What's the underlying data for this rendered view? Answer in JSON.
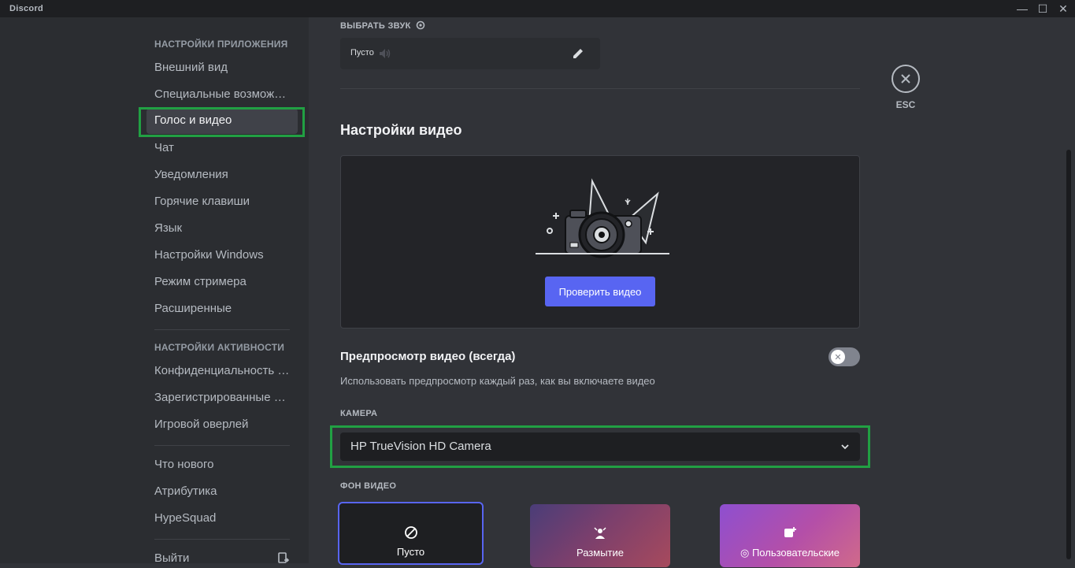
{
  "window": {
    "title": "Discord",
    "minimize_glyph": "—",
    "maximize_glyph": "☐",
    "close_glyph": "✕"
  },
  "sidebar": {
    "app_settings_header": "НАСТРОЙКИ ПРИЛОЖЕНИЯ",
    "app_items": [
      {
        "label": "Внешний вид",
        "active": false
      },
      {
        "label": "Специальные возмож…",
        "active": false
      },
      {
        "label": "Голос и видео",
        "active": true
      },
      {
        "label": "Чат",
        "active": false
      },
      {
        "label": "Уведомления",
        "active": false
      },
      {
        "label": "Горячие клавиши",
        "active": false
      },
      {
        "label": "Язык",
        "active": false
      },
      {
        "label": "Настройки Windows",
        "active": false
      },
      {
        "label": "Режим стримера",
        "active": false
      },
      {
        "label": "Расширенные",
        "active": false
      }
    ],
    "activity_settings_header": "НАСТРОЙКИ АКТИВНОСТИ",
    "activity_items": [
      {
        "label": "Конфиденциальность …"
      },
      {
        "label": "Зарегистрированные …"
      },
      {
        "label": "Игровой оверлей"
      }
    ],
    "misc_items": [
      {
        "label": "Что нового"
      },
      {
        "label": "Атрибутика"
      },
      {
        "label": "HypeSquad"
      }
    ],
    "logout_label": "Выйти"
  },
  "sound": {
    "label": "ВЫБРАТЬ ЗВУК",
    "value": "Пусто"
  },
  "video": {
    "title": "Настройки видео",
    "test_button": "Проверить видео",
    "preview_title": "Предпросмотр видео (всегда)",
    "preview_desc": "Использовать предпросмотр каждый раз, как вы включаете видео",
    "preview_enabled": false,
    "camera_label": "КАМЕРА",
    "camera_value": "HP TrueVision HD Camera",
    "background_label": "ФОН ВИДЕО",
    "backgrounds": [
      {
        "label": "Пусто",
        "selected": true
      },
      {
        "label": "Размытие",
        "selected": false
      },
      {
        "label": "Пользовательские",
        "selected": false
      }
    ]
  },
  "close": {
    "label": "ESC"
  },
  "colors": {
    "accent": "#5865f2",
    "highlight": "#21a043",
    "background": "#313338",
    "sidebar": "#2b2d31"
  }
}
